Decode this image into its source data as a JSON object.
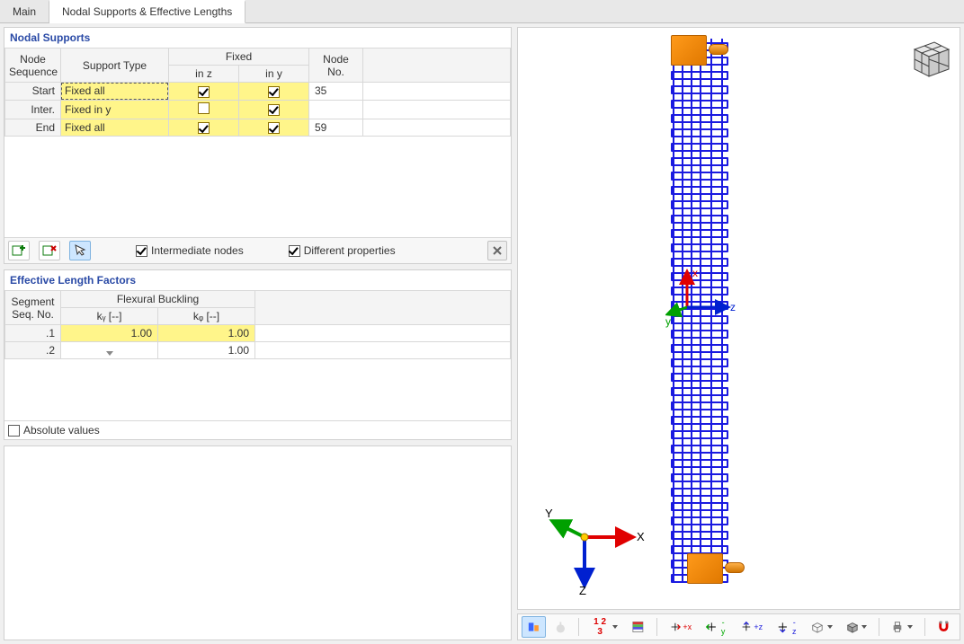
{
  "tabs": {
    "main": "Main",
    "nodal": "Nodal Supports & Effective Lengths"
  },
  "ns": {
    "title": "Nodal Supports",
    "headers": {
      "seq": "Node\nSequence",
      "type": "Support Type",
      "fixed": "Fixed",
      "inz": "in z",
      "iny": "in y",
      "node": "Node\nNo."
    },
    "rows": [
      {
        "seq": "Start",
        "type": "Fixed all",
        "z": true,
        "y": true,
        "node": "35",
        "sel": true
      },
      {
        "seq": "Inter.",
        "type": "Fixed in y",
        "z": false,
        "y": true,
        "node": ""
      },
      {
        "seq": "End",
        "type": "Fixed all",
        "z": true,
        "y": true,
        "node": "59"
      }
    ],
    "intermediate": "Intermediate nodes",
    "diffprops": "Different properties"
  },
  "elf": {
    "title": "Effective Length Factors",
    "headers": {
      "seg": "Segment\nSeq. No.",
      "flex": "Flexural Buckling",
      "ky": "kᵧ [--]",
      "kz": "kᵩ [--]"
    },
    "rows": [
      {
        "seg": ".1",
        "ky": "1.00",
        "kz": "1.00",
        "hl": true
      },
      {
        "seg": ".2",
        "ky": "",
        "kz": "1.00",
        "dd": true
      }
    ],
    "absvals": "Absolute values"
  },
  "axes": {
    "x": "x",
    "y": "y",
    "z": "z",
    "X": "X",
    "Y": "Y",
    "Z": "Z"
  },
  "tb": {
    "num": "1 2 3",
    "px": "+x",
    "my": "-y",
    "pz": "+z",
    "mz": "-z"
  }
}
